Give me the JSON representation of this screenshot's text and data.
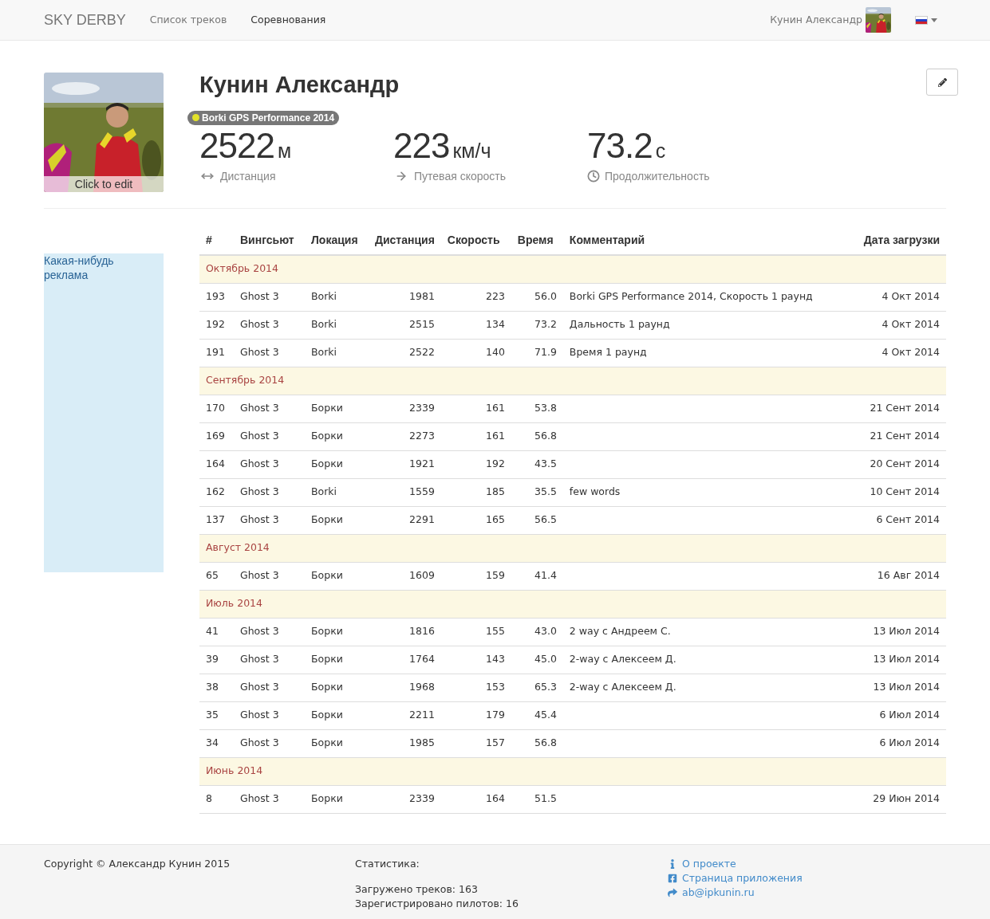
{
  "navbar": {
    "brand": "SKY DERBY",
    "links": [
      {
        "label": "Список треков",
        "selected": false
      },
      {
        "label": "Соревнования",
        "selected": true
      }
    ],
    "user_name": "Кунин Александр"
  },
  "profile": {
    "name": "Кунин Александр",
    "photo_caption": "Click to edit",
    "badge": "Borki GPS Performance 2014",
    "stats": [
      {
        "kind": "distance",
        "value": "2522",
        "unit": "м",
        "label": "Дистанция"
      },
      {
        "kind": "speed",
        "value": "223",
        "unit": "км/ч",
        "label": "Путевая скорость"
      },
      {
        "kind": "time",
        "value": "73.2",
        "unit": "с",
        "label": "Продолжительность"
      }
    ]
  },
  "ad": {
    "text": "Какая-нибудь реклама"
  },
  "table": {
    "columns": [
      "#",
      "Вингсьют",
      "Локация",
      "Дистанция",
      "Скорость",
      "Время",
      "Комментарий",
      "Дата загрузки"
    ],
    "groups": [
      {
        "title": "Октябрь 2014",
        "rows": [
          [
            "193",
            "Ghost 3",
            "Borki",
            "1981",
            "223",
            "56.0",
            "Borki GPS Performance 2014, Скорость 1 раунд",
            "4 Окт 2014"
          ],
          [
            "192",
            "Ghost 3",
            "Borki",
            "2515",
            "134",
            "73.2",
            "Дальность 1 раунд",
            "4 Окт 2014"
          ],
          [
            "191",
            "Ghost 3",
            "Borki",
            "2522",
            "140",
            "71.9",
            "Время 1 раунд",
            "4 Окт 2014"
          ]
        ]
      },
      {
        "title": "Сентябрь 2014",
        "rows": [
          [
            "170",
            "Ghost 3",
            "Борки",
            "2339",
            "161",
            "53.8",
            "",
            "21 Сент 2014"
          ],
          [
            "169",
            "Ghost 3",
            "Борки",
            "2273",
            "161",
            "56.8",
            "",
            "21 Сент 2014"
          ],
          [
            "164",
            "Ghost 3",
            "Борки",
            "1921",
            "192",
            "43.5",
            "",
            "20 Сент 2014"
          ],
          [
            "162",
            "Ghost 3",
            "Borki",
            "1559",
            "185",
            "35.5",
            "few words",
            "10 Сент 2014"
          ],
          [
            "137",
            "Ghost 3",
            "Борки",
            "2291",
            "165",
            "56.5",
            "",
            "6 Сент 2014"
          ]
        ]
      },
      {
        "title": "Август 2014",
        "rows": [
          [
            "65",
            "Ghost 3",
            "Борки",
            "1609",
            "159",
            "41.4",
            "",
            "16 Авг 2014"
          ]
        ]
      },
      {
        "title": "Июль 2014",
        "rows": [
          [
            "41",
            "Ghost 3",
            "Борки",
            "1816",
            "155",
            "43.0",
            "2 way с Андреем С.",
            "13 Июл 2014"
          ],
          [
            "39",
            "Ghost 3",
            "Борки",
            "1764",
            "143",
            "45.0",
            "2-way с Алексеем Д.",
            "13 Июл 2014"
          ],
          [
            "38",
            "Ghost 3",
            "Борки",
            "1968",
            "153",
            "65.3",
            "2-way с Алексеем Д.",
            "13 Июл 2014"
          ],
          [
            "35",
            "Ghost 3",
            "Борки",
            "2211",
            "179",
            "45.4",
            "",
            "6 Июл 2014"
          ],
          [
            "34",
            "Ghost 3",
            "Борки",
            "1985",
            "157",
            "56.8",
            "",
            "6 Июл 2014"
          ]
        ]
      },
      {
        "title": "Июнь 2014",
        "rows": [
          [
            "8",
            "Ghost 3",
            "Борки",
            "2339",
            "164",
            "51.5",
            "",
            "29 Июн 2014"
          ]
        ]
      }
    ]
  },
  "footer": {
    "copyright": "Copyright © Александр Кунин 2015",
    "stats_title": "Статистика:",
    "stats": [
      "Загружено треков: 163",
      "Зарегистрировано пилотов: 16"
    ],
    "links": [
      {
        "kind": "info",
        "label": "О проекте"
      },
      {
        "kind": "facebook",
        "label": "Страница приложения"
      },
      {
        "kind": "share",
        "label": "ab@ipkunin.ru"
      }
    ]
  }
}
